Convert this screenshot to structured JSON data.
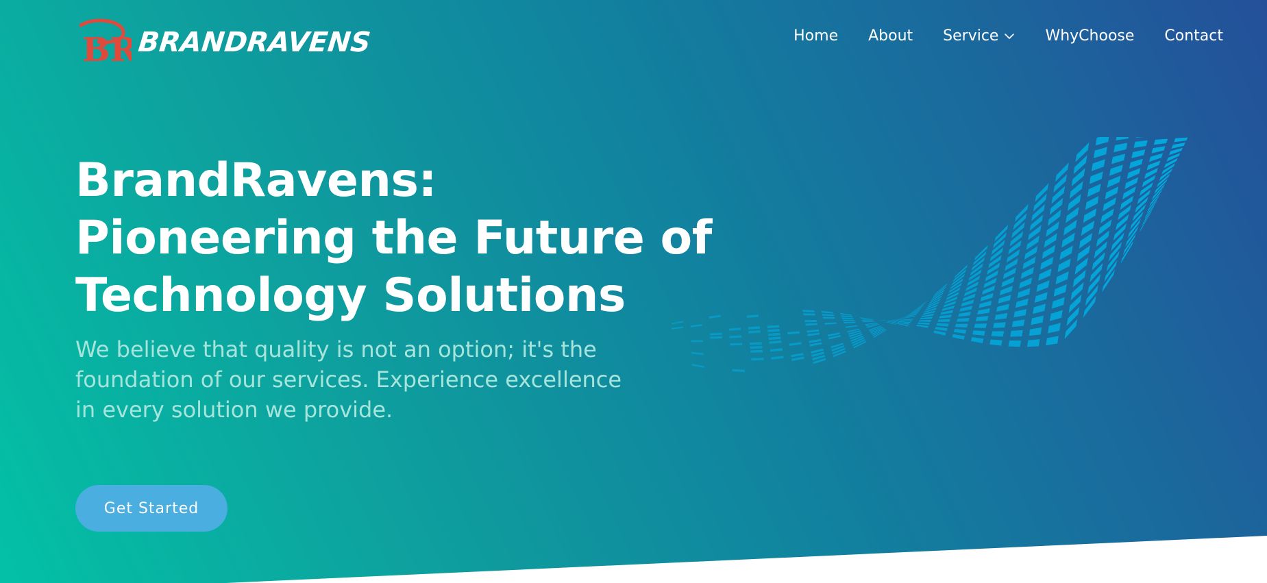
{
  "brand": {
    "name": "BRANDRAVENS",
    "logo_letters": "BR",
    "logo_color": "#e04a3d"
  },
  "nav": {
    "items": [
      {
        "label": "Home"
      },
      {
        "label": "About"
      },
      {
        "label": "Service",
        "has_dropdown": true,
        "icon": "chevron-down-icon"
      },
      {
        "label": "WhyChoose"
      },
      {
        "label": "Contact"
      }
    ]
  },
  "hero": {
    "headline_lines": [
      "BrandRavens:",
      "Pioneering the Future of",
      "Technology Solutions"
    ],
    "subtitle": "We believe that quality is not an option; it's the foundation of our services. Experience excellence in every solution we provide.",
    "cta_label": "Get Started"
  },
  "colors": {
    "gradient_start": "#03c1a6",
    "gradient_end": "#24509a",
    "cta_bg": "#4aaee0",
    "subtitle": "#a6e4dc",
    "wave_tiles": "#03a9dd"
  }
}
